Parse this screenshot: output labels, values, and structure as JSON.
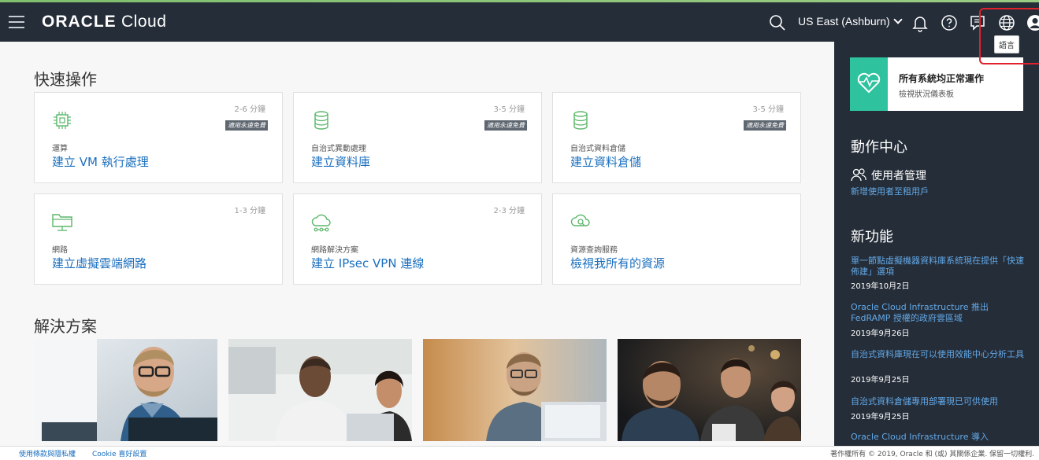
{
  "header": {
    "logo_brand": "ORACLE",
    "logo_product": "Cloud",
    "region": "US East (Ashburn)",
    "tooltip": "語言"
  },
  "quick_actions": {
    "title": "快速操作",
    "cards": [
      {
        "time": "2-6 分鐘",
        "badge": "適用永遠免費",
        "category": "運算",
        "link": "建立 VM 執行處理",
        "icon": "chip-icon"
      },
      {
        "time": "3-5 分鐘",
        "badge": "適用永遠免費",
        "category": "自治式異動處理",
        "link": "建立資料庫",
        "icon": "database-icon"
      },
      {
        "time": "3-5 分鐘",
        "badge": "適用永遠免費",
        "category": "自治式資料倉儲",
        "link": "建立資料倉儲",
        "icon": "database-icon"
      },
      {
        "time": "1-3 分鐘",
        "badge": "",
        "category": "網路",
        "link": "建立虛擬雲端網路",
        "icon": "network-folder-icon"
      },
      {
        "time": "2-3 分鐘",
        "badge": "",
        "category": "網路解決方案",
        "link": "建立 IPsec VPN 連線",
        "icon": "cloud-network-icon"
      },
      {
        "time": "",
        "badge": "",
        "category": "資源查詢服務",
        "link": "檢視我所有的資源",
        "icon": "cloud-search-icon"
      }
    ]
  },
  "solutions": {
    "title": "解決方案"
  },
  "sidebar": {
    "status_title": "所有系統均正常運作",
    "status_sub": "檢視狀況儀表板",
    "action_center_title": "動作中心",
    "user_mgmt_label": "使用者管理",
    "user_mgmt_link": "新增使用者至租用戶",
    "whats_new_title": "新功能",
    "news": [
      {
        "text": "單一節點虛擬機器資料庫系統現在提供「快速佈建」選項",
        "date": "2019年10月2日"
      },
      {
        "text": "Oracle Cloud Infrastructure 推出 FedRAMP 授權的政府雲區域",
        "date": "2019年9月26日"
      },
      {
        "text": "自治式資料庫現在可以使用效能中心分析工具",
        "date": "2019年9月25日"
      },
      {
        "text": "自治式資料倉儲專用部署現已可供使用",
        "date": "2019年9月25日"
      },
      {
        "text": "Oracle Cloud Infrastructure 導入",
        "date": ""
      }
    ]
  },
  "footer": {
    "terms": "使用條款與隱私權",
    "cookie": "Cookie 喜好設置",
    "copyright": "著作權所有 © 2019, Oracle 和 (或) 其關係企業. 保留一切權利."
  },
  "colors": {
    "header_bg": "#252d38",
    "link": "#1a6fbf",
    "status_green": "#2ec29e",
    "highlight_red": "#e0222c"
  }
}
